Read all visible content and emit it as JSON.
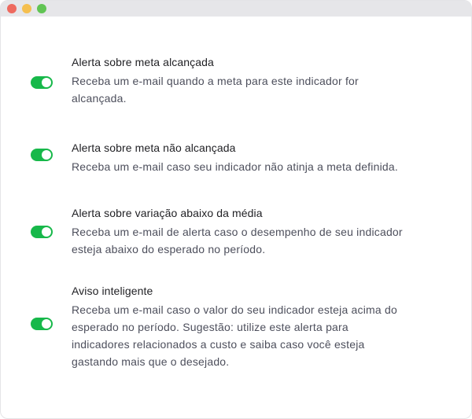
{
  "settings": [
    {
      "title": "Alerta sobre meta alcançada",
      "desc_lines": [
        "Receba um e-mail quando a meta para este indicador for",
        "alcançada."
      ],
      "enabled": true
    },
    {
      "title": "Alerta sobre meta não alcançada",
      "desc_lines": [
        "Receba um e-mail caso seu indicador não atinja a meta definida."
      ],
      "enabled": true
    },
    {
      "title": "Alerta sobre variação abaixo da média",
      "desc_lines": [
        "Receba um e-mail de alerta caso o desempenho de seu indicador",
        "esteja abaixo do esperado no período."
      ],
      "enabled": true
    },
    {
      "title": "Aviso inteligente",
      "desc_lines": [
        "Receba um e-mail caso o valor do seu indicador esteja acima do",
        "esperado no período. Sugestão: utilize este alerta para",
        "indicadores relacionados a custo e saiba caso você esteja",
        "gastando mais que o desejado."
      ],
      "enabled": true
    }
  ],
  "colors": {
    "toggle_on": "#17b84a",
    "window_close": "#ee6a5f",
    "window_minimize": "#f5bf4f",
    "window_zoom": "#61c454"
  }
}
